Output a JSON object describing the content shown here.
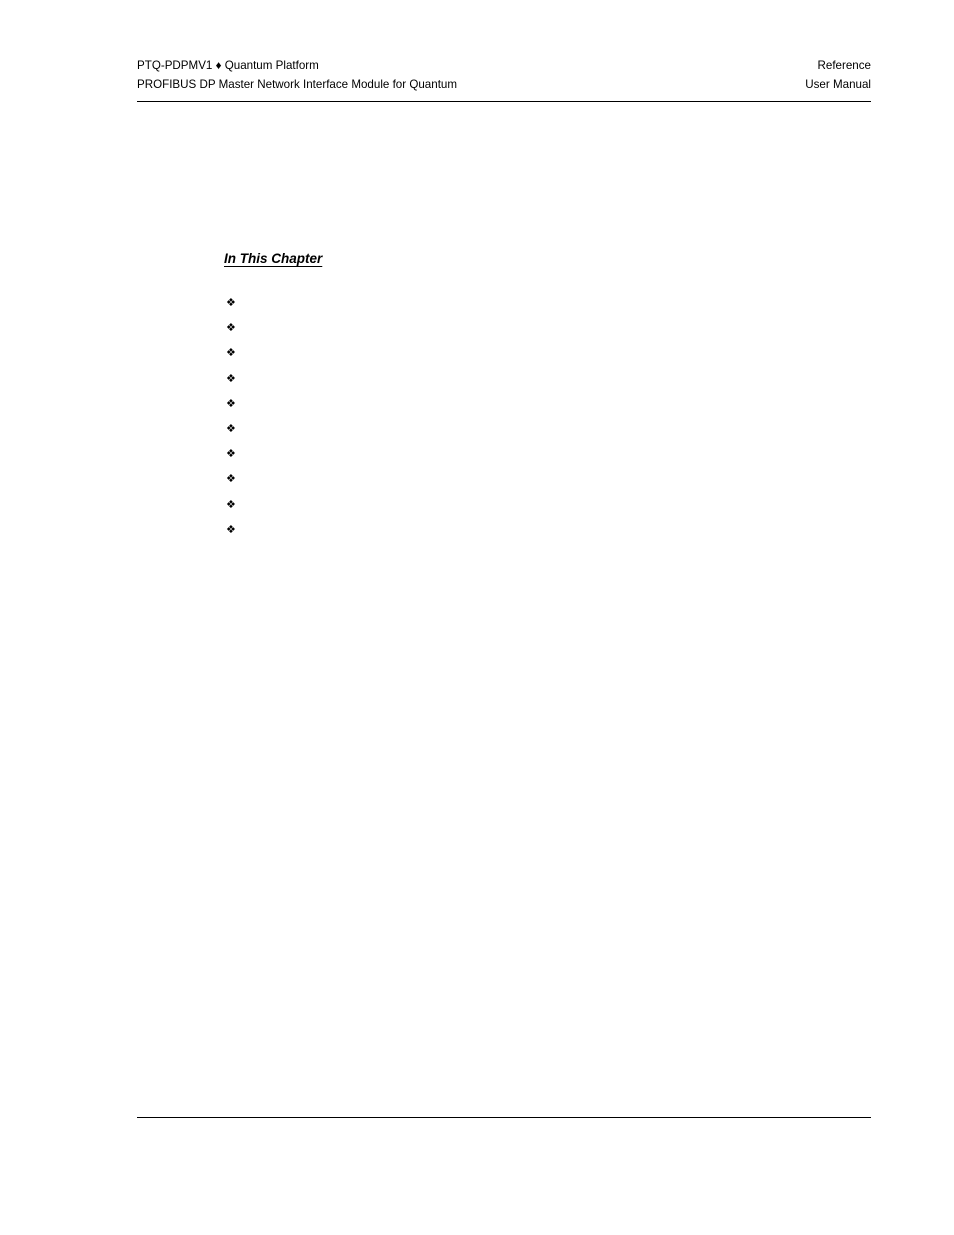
{
  "document": {
    "header": {
      "left_line_1": "PTQ-PDPMV1 ♦ Quantum Platform",
      "left_line_2": "PROFIBUS DP Master Network Interface Module for Quantum",
      "right_line_1": "Reference",
      "right_line_2": "User Manual",
      "separator_icon": "filled-diamond-icon"
    },
    "chapter": {
      "in_this_chapter_heading": "In This Chapter",
      "bullet_glyph": "❖",
      "bullet_icon_name": "floret-diamond-bullet-icon",
      "toc_entries": [
        {
          "label": "",
          "page": ""
        },
        {
          "label": "",
          "page": ""
        },
        {
          "label": "",
          "page": ""
        },
        {
          "label": "",
          "page": ""
        },
        {
          "label": "",
          "page": ""
        },
        {
          "label": "",
          "page": ""
        },
        {
          "label": "",
          "page": ""
        },
        {
          "label": "",
          "page": ""
        },
        {
          "label": "",
          "page": ""
        },
        {
          "label": "",
          "page": ""
        }
      ]
    },
    "footer": {
      "left_text": "",
      "right_text": ""
    },
    "colors": {
      "text": "#000000",
      "background": "#ffffff",
      "rule": "#000000"
    }
  }
}
